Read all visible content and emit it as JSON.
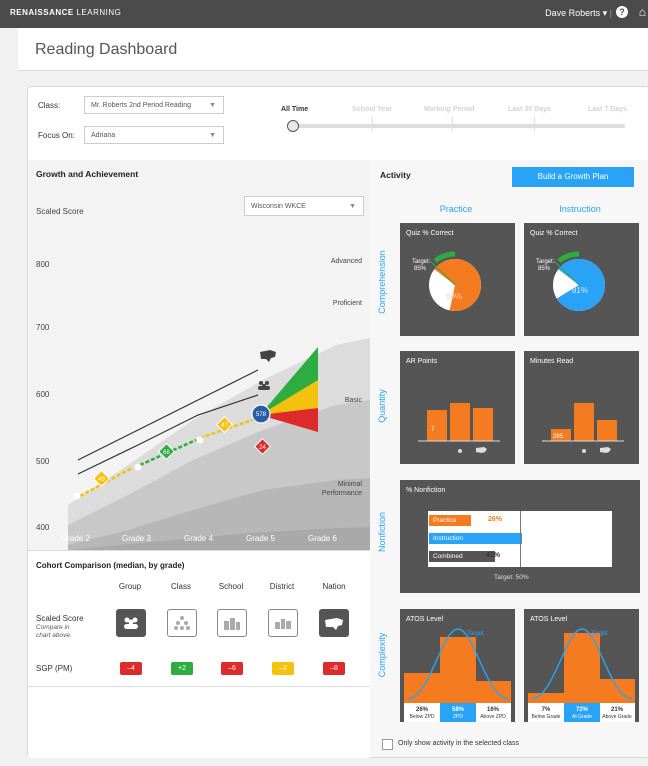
{
  "header": {
    "logo_bold": "RENAISSANCE",
    "logo_light": "LEARNING",
    "user": "Dave Roberts",
    "help_glyph": "?",
    "home_glyph": "⌂"
  },
  "page_title": "Reading Dashboard",
  "filters": {
    "class_label": "Class:",
    "class_value": "Mr. Roberts 2nd Period Reading",
    "focus_label": "Focus On:",
    "focus_value": "Adriana",
    "timeline": [
      "All Time",
      "School Year",
      "Marking Period",
      "Last 30 Days",
      "Last 7 Days"
    ],
    "timeline_selected": "All Time"
  },
  "growth": {
    "title": "Growth and Achievement",
    "y_label": "Scaled Score",
    "benchmark_select": "Wisconsin WKCE",
    "y_ticks": [
      "800",
      "700",
      "600",
      "500",
      "400"
    ],
    "bands": [
      "Advanced",
      "Proficient",
      "Basic",
      "Minimal",
      "Performance"
    ],
    "grades": [
      "Grade 2",
      "Grade 3",
      "Grade 4",
      "Grade 5",
      "Grade 6"
    ],
    "sgp_markers": [
      "49",
      "68",
      "47",
      "24"
    ],
    "current_score": "578"
  },
  "cohort": {
    "title": "Cohort Comparison (median, by grade)",
    "columns": [
      "Group",
      "Class",
      "School",
      "District",
      "Nation"
    ],
    "row1_label": "Scaled Score",
    "row1_sub_line1": "Compare in",
    "row1_sub_line2": "chart above.",
    "row2_label": "SGP (PM)",
    "sgp_values": [
      "–4",
      "+2",
      "–6",
      "–2",
      "–8"
    ],
    "sgp_colors": [
      "#dd2a2a",
      "#2eac3f",
      "#dd2a2a",
      "#f4c20d",
      "#dd2a2a"
    ]
  },
  "activity": {
    "title": "Activity",
    "button": "Build a Growth Plan",
    "col_practice": "Practice",
    "col_instruction": "Instruction",
    "row_comprehension": "Comprehension",
    "row_quantity": "Quantity",
    "row_nonfiction": "Nonfiction",
    "row_complexity": "Complexity",
    "quiz_practice": {
      "title": "Quiz % Correct",
      "target_label": "Target:",
      "target": "85%",
      "value": "68%",
      "fraction": 0.68
    },
    "quiz_instruction": {
      "title": "Quiz % Correct",
      "target_label": "Target:",
      "target": "85%",
      "value": "81%",
      "fraction": 0.81
    },
    "ar_points": {
      "title": "AR Points",
      "value": "7"
    },
    "minutes_read": {
      "title": "Minutes Read",
      "value": "285"
    },
    "nonfiction": {
      "title": "% Nonfiction",
      "bars": [
        {
          "label": "Practice",
          "value": "26%",
          "fraction": 0.26,
          "color": "#f47b20"
        },
        {
          "label": "Instruction",
          "value": "58%",
          "fraction": 0.58,
          "color": "#29a3f5"
        },
        {
          "label": "Combined",
          "value": "41%",
          "fraction": 0.41,
          "color": "#555555"
        }
      ],
      "target": "Target: 50%"
    },
    "atos_practice": {
      "title": "ATOS Level",
      "target": "Target",
      "bins": [
        {
          "pct": "26%",
          "label": "Below ZPD"
        },
        {
          "pct": "58%",
          "label": "ZPD"
        },
        {
          "pct": "16%",
          "label": "Above ZPD"
        }
      ]
    },
    "atos_instruction": {
      "title": "ATOS Level",
      "target": "Target",
      "bins": [
        {
          "pct": "7%",
          "label": "Below Grade"
        },
        {
          "pct": "72%",
          "label": "At Grade"
        },
        {
          "pct": "21%",
          "label": "Above Grade"
        }
      ]
    },
    "checkbox_label": "Only show activity in the selected class"
  },
  "colors": {
    "accent": "#29a3f5",
    "orange": "#f47b20",
    "card": "#555555"
  }
}
